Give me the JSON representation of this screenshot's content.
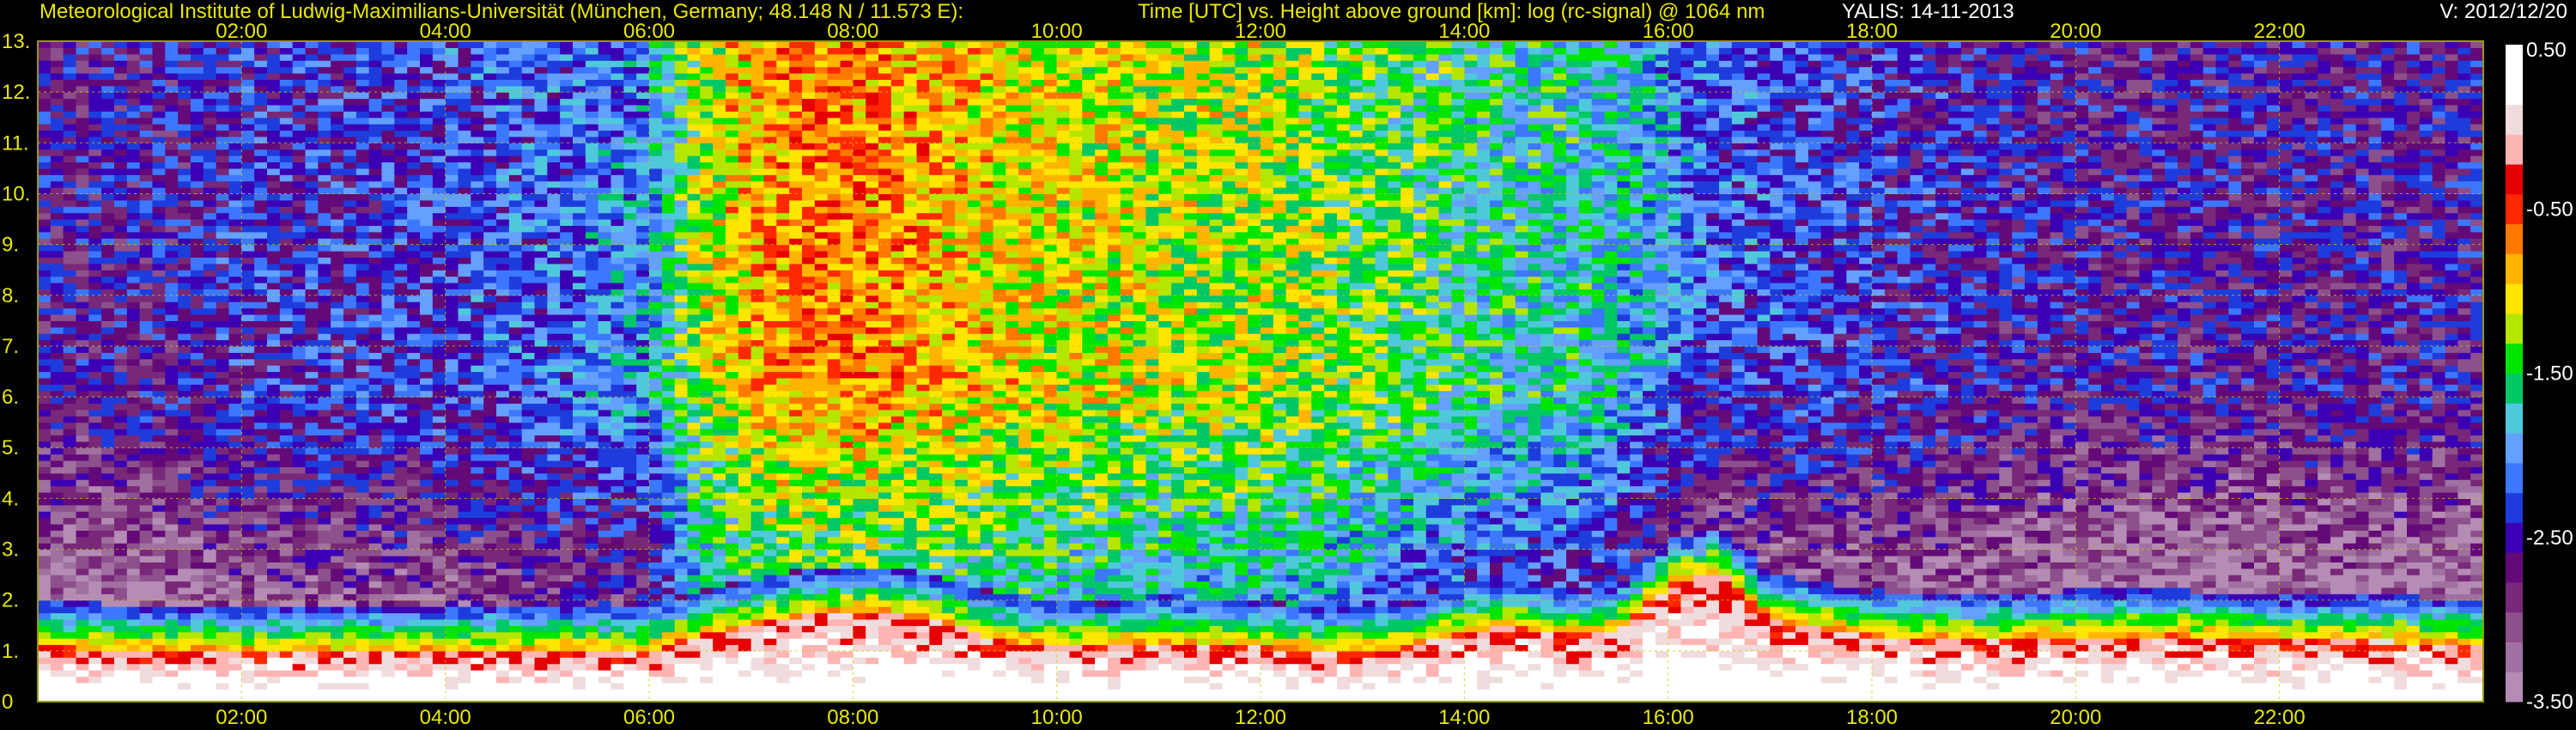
{
  "header": {
    "institute": "Meteorological Institute of Ludwig-Maximilians-Universität (München, Germany; 48.148 N / 11.573 E):",
    "axes_desc": "Time [UTC] vs. Height above ground [km]: log (rc-signal) @ 1064 nm",
    "instrument_date": "YALIS: 14-11-2013",
    "version": "V: 2012/12/20"
  },
  "chart_data": {
    "type": "heatmap",
    "x_ticks": [
      "02:00",
      "04:00",
      "06:00",
      "08:00",
      "10:00",
      "12:00",
      "14:00",
      "16:00",
      "18:00",
      "20:00",
      "22:00"
    ],
    "x_tick_hours": [
      2,
      4,
      6,
      8,
      10,
      12,
      14,
      16,
      18,
      20,
      22
    ],
    "xlim_hours": [
      0,
      24
    ],
    "y_ticks": [
      "0",
      "1.",
      "2.",
      "3.",
      "4.",
      "5.",
      "6.",
      "7.",
      "8.",
      "9.",
      "10.",
      "11.",
      "12.",
      "13."
    ],
    "ylim_km": [
      0,
      13
    ],
    "grid": true,
    "colorbar": {
      "ticks": [
        "0.50",
        "-0.50",
        "-1.50",
        "-2.50",
        "-3.50"
      ],
      "values": [
        0.5,
        -0.5,
        -1.5,
        -2.5,
        -3.5
      ],
      "range": [
        -3.5,
        0.5
      ],
      "colors": [
        "#b48cb4",
        "#a070a0",
        "#8c508c",
        "#782878",
        "#640a78",
        "#3c00b4",
        "#1e3cdc",
        "#3c78ff",
        "#64a0ff",
        "#50c8dc",
        "#00c864",
        "#00e600",
        "#b4e600",
        "#ffe600",
        "#ffb400",
        "#ff7800",
        "#ff2800",
        "#e60000",
        "#ffb4b4",
        "#f0dcdc",
        "#ffffff",
        "#ffffff"
      ]
    },
    "time_series_hours": [
      0,
      1,
      2,
      3,
      4,
      5,
      6,
      6.5,
      7,
      7.5,
      8,
      8.5,
      9,
      9.5,
      10,
      10.5,
      11,
      11.5,
      12,
      12.5,
      13,
      13.5,
      14,
      14.5,
      15,
      15.5,
      16,
      16.5,
      17,
      18,
      19,
      20,
      21,
      22,
      23,
      24
    ],
    "boundary_layer_top_km": [
      1.1,
      1.0,
      1.0,
      1.0,
      1.0,
      1.0,
      1.0,
      1.3,
      1.5,
      1.7,
      1.8,
      1.7,
      1.5,
      1.2,
      1.1,
      1.1,
      1.2,
      1.1,
      1.1,
      1.0,
      1.0,
      1.1,
      1.4,
      1.5,
      1.3,
      1.4,
      2.3,
      2.6,
      1.6,
      1.3,
      1.2,
      1.3,
      1.3,
      1.2,
      1.2,
      1.1
    ],
    "background_signal": [
      -2.6,
      -2.6,
      -2.4,
      -2.4,
      -2.3,
      -2.2,
      -2.0,
      -1.2,
      -0.9,
      -0.7,
      -0.7,
      -0.8,
      -0.9,
      -1.0,
      -1.1,
      -1.1,
      -1.2,
      -1.2,
      -1.2,
      -1.3,
      -1.4,
      -1.5,
      -1.6,
      -1.7,
      -1.7,
      -1.8,
      -2.0,
      -2.2,
      -2.3,
      -2.4,
      -2.5,
      -2.6,
      -2.6,
      -2.6,
      -2.6,
      -2.6
    ]
  }
}
